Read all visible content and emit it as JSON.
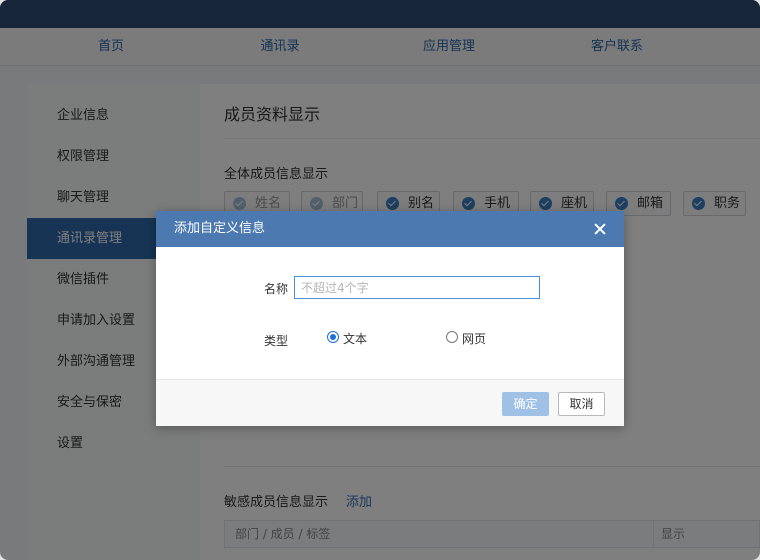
{
  "top_nav": [
    "首页",
    "通讯录",
    "应用管理",
    "客户联系"
  ],
  "sidebar": {
    "items": [
      "企业信息",
      "权限管理",
      "聊天管理",
      "通讯录管理",
      "微信插件",
      "申请加入设置",
      "外部沟通管理",
      "安全与保密",
      "设置"
    ],
    "active": "通讯录管理"
  },
  "main": {
    "title": "成员资料显示",
    "all_info_label": "全体成员信息显示",
    "chips": [
      {
        "label": "姓名",
        "locked": true
      },
      {
        "label": "部门",
        "locked": true
      },
      {
        "label": "别名",
        "locked": false
      },
      {
        "label": "手机",
        "locked": false
      },
      {
        "label": "座机",
        "locked": false
      },
      {
        "label": "邮箱",
        "locked": false
      },
      {
        "label": "职务",
        "locked": false
      }
    ],
    "sensitive_label": "敏感成员信息显示",
    "sensitive_add": "添加",
    "table": {
      "col1": "部门 / 成员 / 标签",
      "col2": "显示"
    }
  },
  "dialog": {
    "title": "添加自定义信息",
    "name_label": "名称",
    "name_placeholder": "不超过4个字",
    "name_value": "",
    "type_label": "类型",
    "options": [
      {
        "label": "文本",
        "selected": true
      },
      {
        "label": "网页",
        "selected": false
      }
    ],
    "ok": "确定",
    "cancel": "取消"
  },
  "colors": {
    "titlebar": "#2d4a6f",
    "accent": "#2f69a9",
    "dialog_header": "#4b79b0",
    "ok_disabled": "#9fc1e6",
    "checkbox": "#3b7ec2"
  }
}
